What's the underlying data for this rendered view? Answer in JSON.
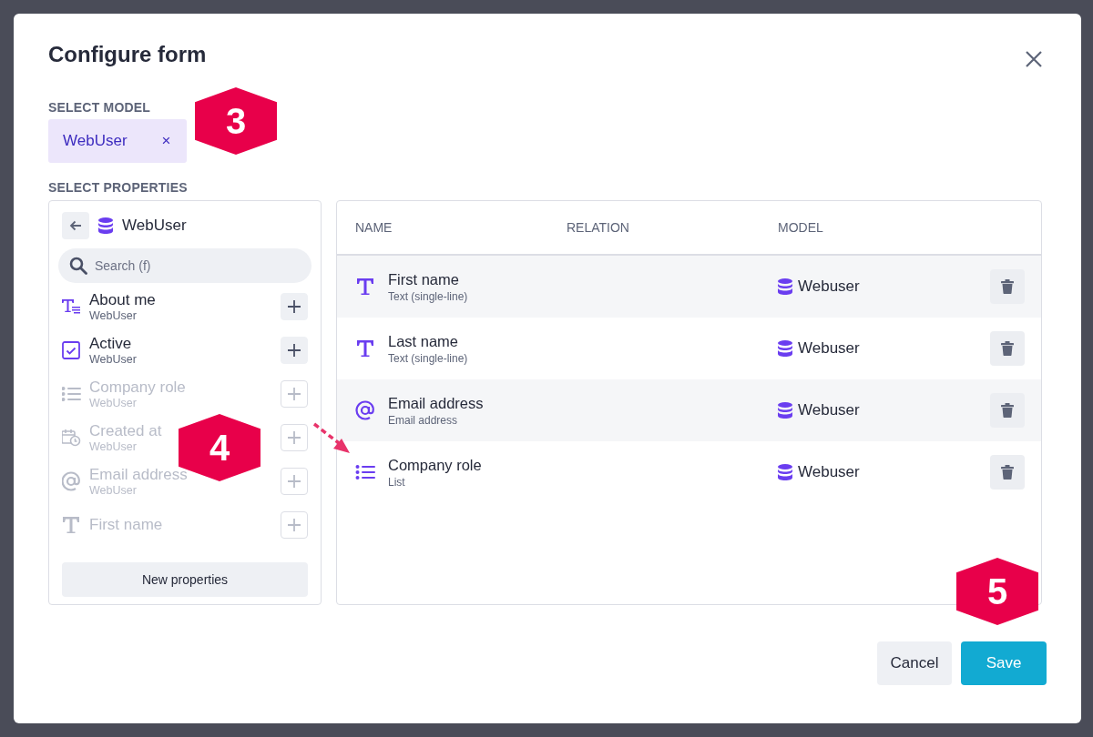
{
  "dialog": {
    "title": "Configure form"
  },
  "select_model": {
    "label": "SELECT MODEL",
    "chip": "WebUser",
    "remove": "×"
  },
  "select_properties": {
    "label": "SELECT PROPERTIES"
  },
  "property_picker": {
    "model": "WebUser",
    "search": {
      "placeholder": "Search (f)"
    },
    "items": [
      {
        "kind": "textarea",
        "name": "About me",
        "model": "WebUser",
        "disabled": false
      },
      {
        "kind": "checkbox",
        "name": "Active",
        "model": "WebUser",
        "disabled": false
      },
      {
        "kind": "list",
        "name": "Company role",
        "model": "WebUser",
        "disabled": true
      },
      {
        "kind": "datetime",
        "name": "Created at",
        "model": "WebUser",
        "disabled": true
      },
      {
        "kind": "email",
        "name": "Email address",
        "model": "WebUser",
        "disabled": true
      },
      {
        "kind": "text",
        "name": "First name",
        "disabled": true
      }
    ],
    "new_button": "New properties"
  },
  "table": {
    "columns": [
      "NAME",
      "RELATION",
      "MODEL"
    ],
    "rows": [
      {
        "kind": "text",
        "name": "First name",
        "type": "Text (single-line)",
        "model": "Webuser"
      },
      {
        "kind": "text",
        "name": "Last name",
        "type": "Text (single-line)",
        "model": "Webuser"
      },
      {
        "kind": "email",
        "name": "Email address",
        "type": "Email address",
        "model": "Webuser"
      },
      {
        "kind": "list",
        "name": "Company role",
        "type": "List",
        "model": "Webuser"
      }
    ]
  },
  "buttons": [
    {
      "label": "Cancel",
      "kind": "secondary"
    },
    {
      "label": "Save",
      "kind": "primary"
    }
  ],
  "callouts": [
    "3",
    "4",
    "5"
  ]
}
